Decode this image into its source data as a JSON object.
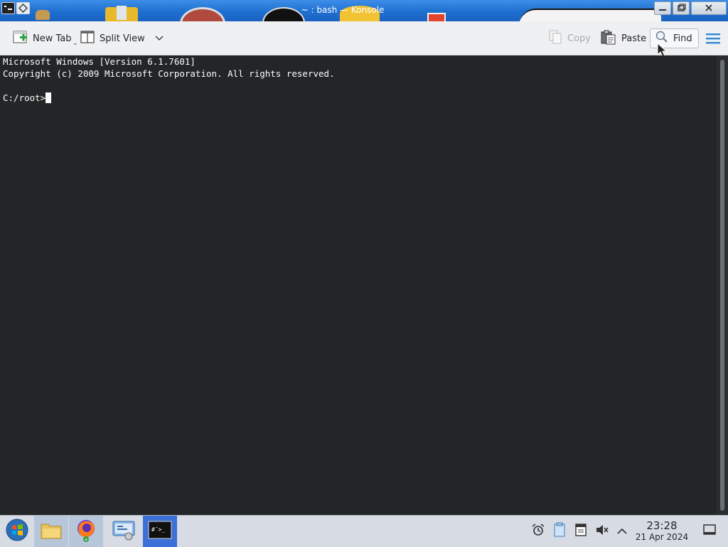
{
  "window": {
    "title": "~ : bash — Konsole"
  },
  "toolbar": {
    "new_tab": "New Tab",
    "split_view": "Split View",
    "copy": "Copy",
    "paste": "Paste",
    "find": "Find"
  },
  "terminal": {
    "lines": [
      "Microsoft Windows [Version 6.1.7601]",
      "Copyright (c) 2009 Microsoft Corporation. All rights reserved.",
      "",
      "C:/root>"
    ]
  },
  "taskbar": {
    "apps": [
      "start-orb-icon",
      "file-manager-icon",
      "firefox-icon",
      "system-settings-icon",
      "konsole-icon"
    ],
    "active_app": "konsole-icon",
    "task_terminal_label": "#¯>_"
  },
  "tray": {
    "icons": [
      "alarm-icon",
      "clipboard-icon",
      "notes-icon",
      "volume-muted-icon",
      "chevron-up-icon"
    ],
    "time": "23:28",
    "date": "21 Apr 2024"
  },
  "colors": {
    "titlebar": "#1f6fd0",
    "terminal_bg": "#232627",
    "terminal_fg": "#fcfcfc",
    "accent": "#3daee9"
  }
}
